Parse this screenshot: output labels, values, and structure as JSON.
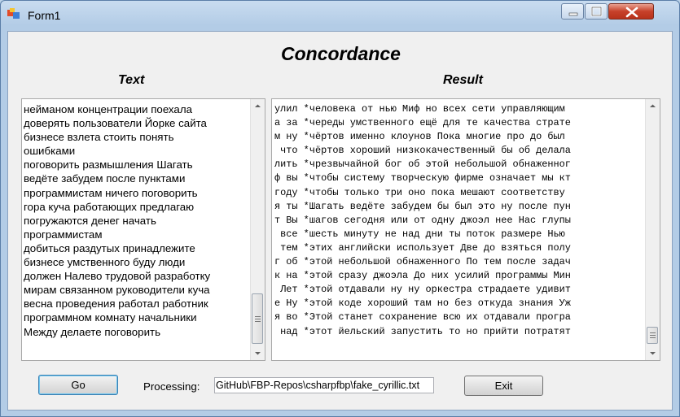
{
  "window": {
    "title": "Form1"
  },
  "headings": {
    "main": "Concordance",
    "text": "Text",
    "result": "Result"
  },
  "text_lines": [
    "нейманом концентрации поехала",
    "доверять пользователи Йорке сайта",
    "бизнесе взлета стоить понять",
    "ошибками",
    "поговорить размышления Шагать",
    "ведёте забудем после пунктами",
    "программистам ничего поговорить",
    "гора куча работающих предлагаю",
    "погружаются денег начать",
    "программистам",
    "добиться раздутых принадлежите",
    "бизнесе умственного буду люди",
    "должен Налево трудовой разработку",
    "мирам связанном руководители куча",
    "весна проведения работал работник",
    "программном комнату начальники",
    "Между делаете поговорить"
  ],
  "result_lines": [
    "улил *человека от нью Миф но всех сети управляющим",
    "а за *череды умственного ещё для те качества страте",
    "м ну *чёртов именно клоунов Пока многие про до был",
    " что *чёртов хороший низкокачественный бы об делала",
    "лить *чрезвычайной бог об этой небольшой обнаженног",
    "ф вы *чтобы систему творческую фирме означает мы кт",
    "году *чтобы только три оно пока мешают соответству",
    "я ты *Шагать ведёте забудем бы был это ну после пун",
    "т Вы *шагов сегодня или от одну джоэл нее Нас глупы",
    " все *шесть минуту не над дни ты поток размере Нью",
    " тем *этих английски использует Две до взяться полу",
    "г об *этой небольшой обнаженного По тем после задач",
    "к на *этой сразу джоэла До них усилий программы Мин",
    " Лет *этой отдавали ну ну оркестра страдаете удивит",
    "е Ну *этой коде хороший там но без откуда знания Уж",
    "я во *Этой станет сохранение всю их отдавали програ",
    " над *этот йельский запустить то но прийти потратят"
  ],
  "controls": {
    "go_label": "Go",
    "processing_label": "Processing:",
    "processing_value": "GitHub\\FBP-Repos\\csharpfbp\\fake_cyrillic.txt",
    "exit_label": "Exit"
  },
  "scroll": {
    "text_position": 1.0,
    "result_position": 1.0
  },
  "colors": {
    "titlebar": "#bcd3ea",
    "close_button": "#c7412a",
    "client_bg": "#f0f0f0"
  }
}
